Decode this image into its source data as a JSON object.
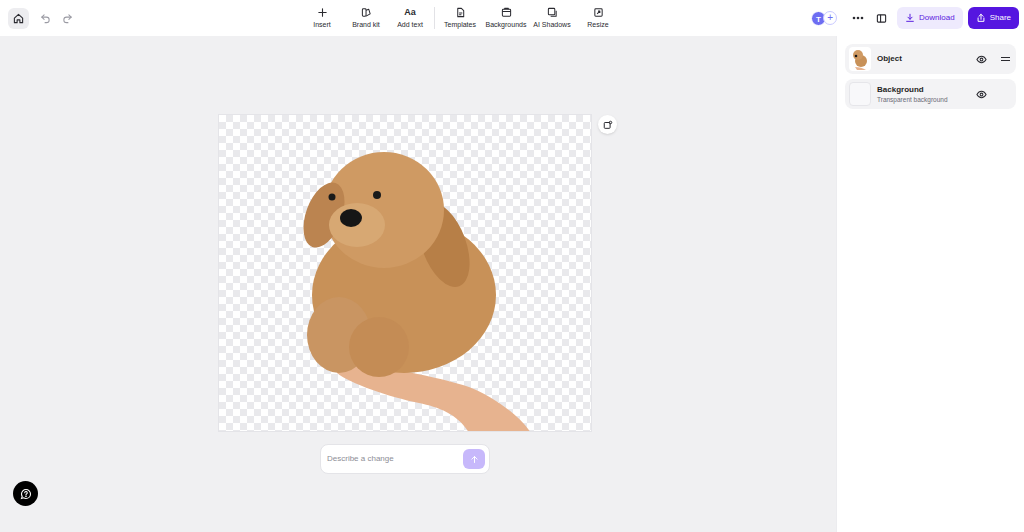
{
  "history": {
    "undo_disabled": true,
    "redo_disabled": true
  },
  "tools": [
    {
      "label": "Insert"
    },
    {
      "label": "Brand kit"
    },
    {
      "label": "Add text",
      "glyph": "Aa"
    },
    {
      "label": "Templates"
    },
    {
      "label": "Backgrounds"
    },
    {
      "label": "AI Shadows"
    },
    {
      "label": "Resize"
    }
  ],
  "account": {
    "avatar": "T",
    "add": "+"
  },
  "actions": {
    "download": "Download",
    "share": "Share"
  },
  "layers": [
    {
      "name": "Object",
      "kind": "object",
      "visible": true
    },
    {
      "name": "Background",
      "subtitle": "Transparent background",
      "kind": "background",
      "visible": true
    }
  ],
  "prompt": {
    "placeholder": "Describe a change"
  }
}
